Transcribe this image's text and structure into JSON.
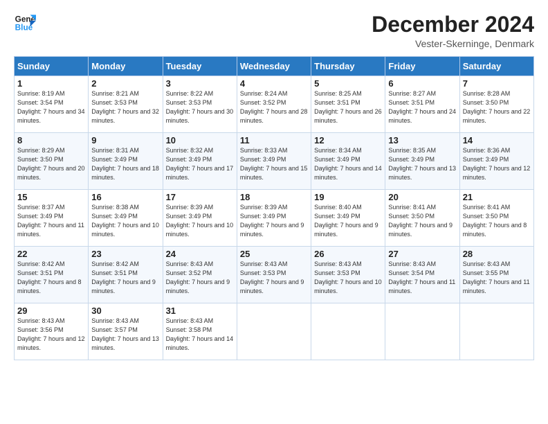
{
  "logo": {
    "line1": "General",
    "line2": "Blue"
  },
  "title": "December 2024",
  "location": "Vester-Skerninge, Denmark",
  "days_of_week": [
    "Sunday",
    "Monday",
    "Tuesday",
    "Wednesday",
    "Thursday",
    "Friday",
    "Saturday"
  ],
  "weeks": [
    [
      {
        "day": 1,
        "sunrise": "8:19 AM",
        "sunset": "3:54 PM",
        "daylight": "7 hours and 34 minutes."
      },
      {
        "day": 2,
        "sunrise": "8:21 AM",
        "sunset": "3:53 PM",
        "daylight": "7 hours and 32 minutes."
      },
      {
        "day": 3,
        "sunrise": "8:22 AM",
        "sunset": "3:53 PM",
        "daylight": "7 hours and 30 minutes."
      },
      {
        "day": 4,
        "sunrise": "8:24 AM",
        "sunset": "3:52 PM",
        "daylight": "7 hours and 28 minutes."
      },
      {
        "day": 5,
        "sunrise": "8:25 AM",
        "sunset": "3:51 PM",
        "daylight": "7 hours and 26 minutes."
      },
      {
        "day": 6,
        "sunrise": "8:27 AM",
        "sunset": "3:51 PM",
        "daylight": "7 hours and 24 minutes."
      },
      {
        "day": 7,
        "sunrise": "8:28 AM",
        "sunset": "3:50 PM",
        "daylight": "7 hours and 22 minutes."
      }
    ],
    [
      {
        "day": 8,
        "sunrise": "8:29 AM",
        "sunset": "3:50 PM",
        "daylight": "7 hours and 20 minutes."
      },
      {
        "day": 9,
        "sunrise": "8:31 AM",
        "sunset": "3:49 PM",
        "daylight": "7 hours and 18 minutes."
      },
      {
        "day": 10,
        "sunrise": "8:32 AM",
        "sunset": "3:49 PM",
        "daylight": "7 hours and 17 minutes."
      },
      {
        "day": 11,
        "sunrise": "8:33 AM",
        "sunset": "3:49 PM",
        "daylight": "7 hours and 15 minutes."
      },
      {
        "day": 12,
        "sunrise": "8:34 AM",
        "sunset": "3:49 PM",
        "daylight": "7 hours and 14 minutes."
      },
      {
        "day": 13,
        "sunrise": "8:35 AM",
        "sunset": "3:49 PM",
        "daylight": "7 hours and 13 minutes."
      },
      {
        "day": 14,
        "sunrise": "8:36 AM",
        "sunset": "3:49 PM",
        "daylight": "7 hours and 12 minutes."
      }
    ],
    [
      {
        "day": 15,
        "sunrise": "8:37 AM",
        "sunset": "3:49 PM",
        "daylight": "7 hours and 11 minutes."
      },
      {
        "day": 16,
        "sunrise": "8:38 AM",
        "sunset": "3:49 PM",
        "daylight": "7 hours and 10 minutes."
      },
      {
        "day": 17,
        "sunrise": "8:39 AM",
        "sunset": "3:49 PM",
        "daylight": "7 hours and 10 minutes."
      },
      {
        "day": 18,
        "sunrise": "8:39 AM",
        "sunset": "3:49 PM",
        "daylight": "7 hours and 9 minutes."
      },
      {
        "day": 19,
        "sunrise": "8:40 AM",
        "sunset": "3:49 PM",
        "daylight": "7 hours and 9 minutes."
      },
      {
        "day": 20,
        "sunrise": "8:41 AM",
        "sunset": "3:50 PM",
        "daylight": "7 hours and 9 minutes."
      },
      {
        "day": 21,
        "sunrise": "8:41 AM",
        "sunset": "3:50 PM",
        "daylight": "7 hours and 8 minutes."
      }
    ],
    [
      {
        "day": 22,
        "sunrise": "8:42 AM",
        "sunset": "3:51 PM",
        "daylight": "7 hours and 8 minutes."
      },
      {
        "day": 23,
        "sunrise": "8:42 AM",
        "sunset": "3:51 PM",
        "daylight": "7 hours and 9 minutes."
      },
      {
        "day": 24,
        "sunrise": "8:43 AM",
        "sunset": "3:52 PM",
        "daylight": "7 hours and 9 minutes."
      },
      {
        "day": 25,
        "sunrise": "8:43 AM",
        "sunset": "3:53 PM",
        "daylight": "7 hours and 9 minutes."
      },
      {
        "day": 26,
        "sunrise": "8:43 AM",
        "sunset": "3:53 PM",
        "daylight": "7 hours and 10 minutes."
      },
      {
        "day": 27,
        "sunrise": "8:43 AM",
        "sunset": "3:54 PM",
        "daylight": "7 hours and 11 minutes."
      },
      {
        "day": 28,
        "sunrise": "8:43 AM",
        "sunset": "3:55 PM",
        "daylight": "7 hours and 11 minutes."
      }
    ],
    [
      {
        "day": 29,
        "sunrise": "8:43 AM",
        "sunset": "3:56 PM",
        "daylight": "7 hours and 12 minutes."
      },
      {
        "day": 30,
        "sunrise": "8:43 AM",
        "sunset": "3:57 PM",
        "daylight": "7 hours and 13 minutes."
      },
      {
        "day": 31,
        "sunrise": "8:43 AM",
        "sunset": "3:58 PM",
        "daylight": "7 hours and 14 minutes."
      },
      null,
      null,
      null,
      null
    ]
  ],
  "labels": {
    "sunrise": "Sunrise:",
    "sunset": "Sunset:",
    "daylight": "Daylight:"
  }
}
